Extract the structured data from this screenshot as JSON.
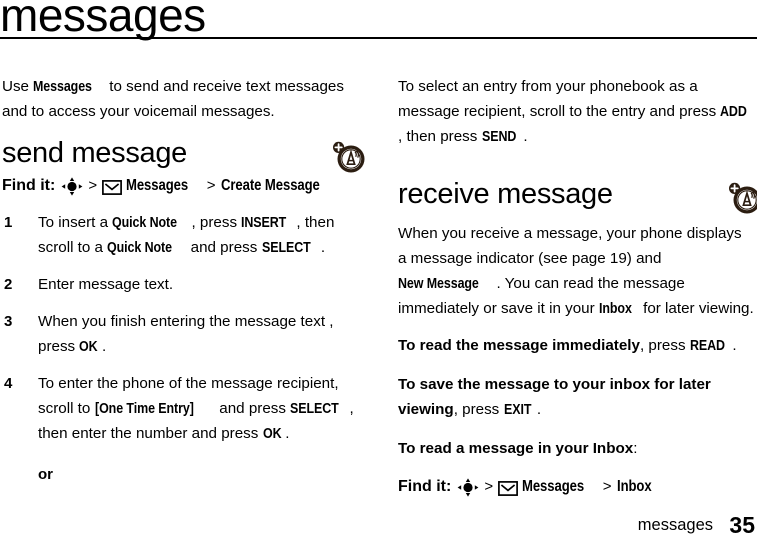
{
  "page": {
    "title": "messages",
    "footer_label": "messages",
    "footer_page": "35",
    "ink_color": "#000000",
    "icon_color": "#2b1d11"
  },
  "left_column": {
    "intro": {
      "part1": "Use ",
      "keyword": "Messages",
      "part2": " to send and receive text messages and to access your voicemail messages."
    },
    "section": {
      "heading": "send message",
      "icon": "antenna-network-icon",
      "find_it": {
        "label": "Find it:",
        "nav_icon": "nav-key-icon",
        "separator": ">",
        "envelope_icon": "envelope-icon",
        "item1": "Messages",
        "item2": "Create Message"
      },
      "steps": [
        {
          "num": "1",
          "segments": [
            {
              "text": "To insert a ",
              "style": "normal"
            },
            {
              "text": "Quick Note",
              "style": "key"
            },
            {
              "text": ", press ",
              "style": "normal"
            },
            {
              "text": "INSERT",
              "style": "key"
            },
            {
              "text": ", then scroll to a ",
              "style": "normal"
            },
            {
              "text": "Quick Note",
              "style": "key"
            },
            {
              "text": " and press ",
              "style": "normal"
            },
            {
              "text": "SELECT",
              "style": "key"
            },
            {
              "text": ".",
              "style": "normal"
            }
          ]
        },
        {
          "num": "2",
          "segments": [
            {
              "text": "Enter message text.",
              "style": "normal"
            }
          ]
        },
        {
          "num": "3",
          "segments": [
            {
              "text": "When you finish entering the message text , press ",
              "style": "normal"
            },
            {
              "text": "OK",
              "style": "key"
            },
            {
              "text": ".",
              "style": "normal"
            }
          ]
        },
        {
          "num": "4",
          "segments": [
            {
              "text": "To enter the phone of the message recipient, scroll to ",
              "style": "normal"
            },
            {
              "text": "[One Time Entry]",
              "style": "key"
            },
            {
              "text": " and press ",
              "style": "normal"
            },
            {
              "text": "SELECT",
              "style": "key"
            },
            {
              "text": ", then enter the number and press ",
              "style": "normal"
            },
            {
              "text": "OK",
              "style": "key"
            },
            {
              "text": ".",
              "style": "normal"
            }
          ],
          "or_label": "or"
        }
      ]
    }
  },
  "right_column": {
    "continuation": {
      "segments": [
        {
          "text": "To select an entry from your phonebook as a message recipient, scroll to the entry and press ",
          "style": "normal"
        },
        {
          "text": "ADD",
          "style": "key"
        },
        {
          "text": ", then press ",
          "style": "normal"
        },
        {
          "text": "SEND",
          "style": "key"
        },
        {
          "text": ".",
          "style": "normal"
        }
      ]
    },
    "section": {
      "heading": "receive message",
      "icon": "antenna-network-icon",
      "intro": {
        "segments": [
          {
            "text": "When you receive a message, your phone displays a message indicator (see page 19) and ",
            "style": "normal"
          },
          {
            "text": "New Message",
            "style": "key"
          },
          {
            "text": ". You can read the message immediately or save it in your ",
            "style": "normal"
          },
          {
            "text": "Inbox",
            "style": "key"
          },
          {
            "text": " for later viewing.",
            "style": "normal"
          }
        ]
      },
      "paragraphs": [
        {
          "segments": [
            {
              "text": "To read the message immediately",
              "style": "lead"
            },
            {
              "text": ", press ",
              "style": "normal"
            },
            {
              "text": "READ",
              "style": "key"
            },
            {
              "text": ".",
              "style": "normal"
            }
          ]
        },
        {
          "segments": [
            {
              "text": "To save the message to your inbox for later viewing",
              "style": "lead"
            },
            {
              "text": ", press ",
              "style": "normal"
            },
            {
              "text": "EXIT",
              "style": "key"
            },
            {
              "text": ".",
              "style": "normal"
            }
          ]
        },
        {
          "segments": [
            {
              "text": "To read a message in your Inbox",
              "style": "lead"
            },
            {
              "text": ":",
              "style": "normal"
            }
          ]
        }
      ],
      "find_it": {
        "label": "Find it:",
        "nav_icon": "nav-key-icon",
        "separator": ">",
        "envelope_icon": "envelope-icon",
        "item1": "Messages",
        "item2": "Inbox"
      }
    }
  }
}
